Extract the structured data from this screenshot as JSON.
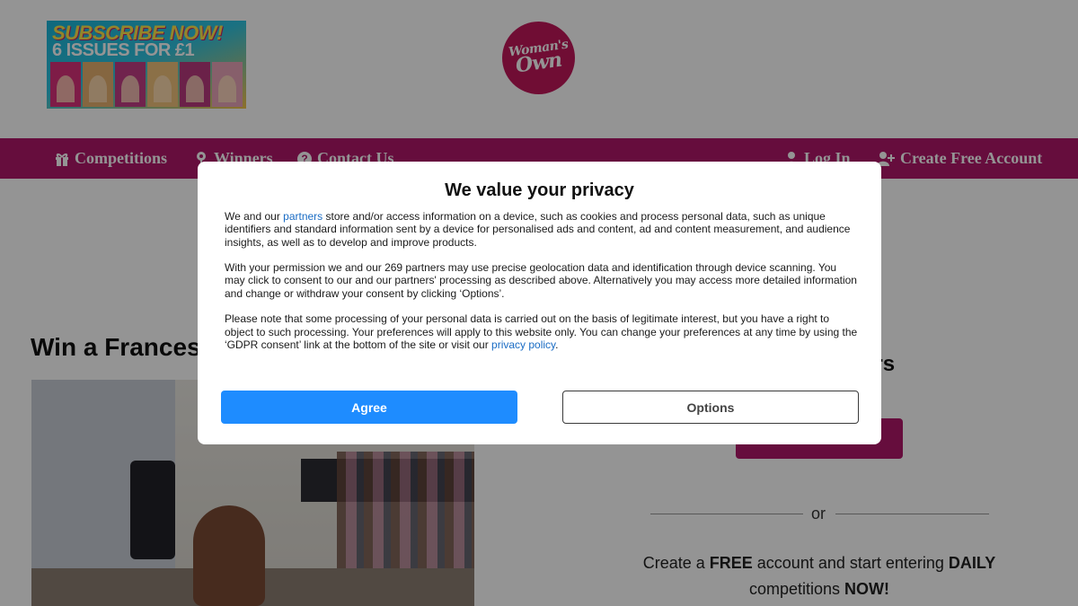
{
  "header": {
    "promo": {
      "line1": "SUBSCRIBE NOW!",
      "line2": "6 ISSUES FOR £1"
    },
    "logo": {
      "line1": "Woman's",
      "line2": "Own"
    }
  },
  "nav": {
    "left": [
      {
        "label": "Competitions",
        "icon": "gift-icon"
      },
      {
        "label": "Winners",
        "icon": "map-pin-icon"
      },
      {
        "label": "Contact Us",
        "icon": "question-icon"
      }
    ],
    "right": [
      {
        "label": "Log In",
        "icon": "user-icon"
      },
      {
        "label": "Create Free Account",
        "icon": "user-plus-icon"
      }
    ]
  },
  "article": {
    "title": "Win a Francesc"
  },
  "sidebar": {
    "heading": "ers",
    "or_label": "or",
    "promo": {
      "p1": "Create a ",
      "b1": "FREE",
      "p2": " account and start entering ",
      "b2": "DAILY",
      "p3": " competitions ",
      "b3": "NOW!"
    }
  },
  "consent": {
    "title": "We value your privacy",
    "para1": {
      "pre": "We and our ",
      "link": "partners",
      "post": " store and/or access information on a device, such as cookies and process personal data, such as unique identifiers and standard information sent by a device for personalised ads and content, ad and content measurement, and audience insights, as well as to develop and improve products."
    },
    "para2": "With your permission we and our 269 partners may use precise geolocation data and identification through device scanning. You may click to consent to our and our partners' processing as described above. Alternatively you may access more detailed information and change or withdraw your consent by clicking ‘Options’.",
    "para3": {
      "pre": "Please note that some processing of your personal data is carried out on the basis of legitimate interest, but you have a right to object to such processing. Your preferences will apply to this website only. You can change your preferences at any time by using the ‘GDPR consent’ link at the bottom of the site or visit our ",
      "link": "privacy policy",
      "post": "."
    },
    "agree_label": "Agree",
    "options_label": "Options"
  },
  "colors": {
    "brand": "#b0176a",
    "agree": "#1e8cff",
    "link": "#1a6cc4"
  }
}
